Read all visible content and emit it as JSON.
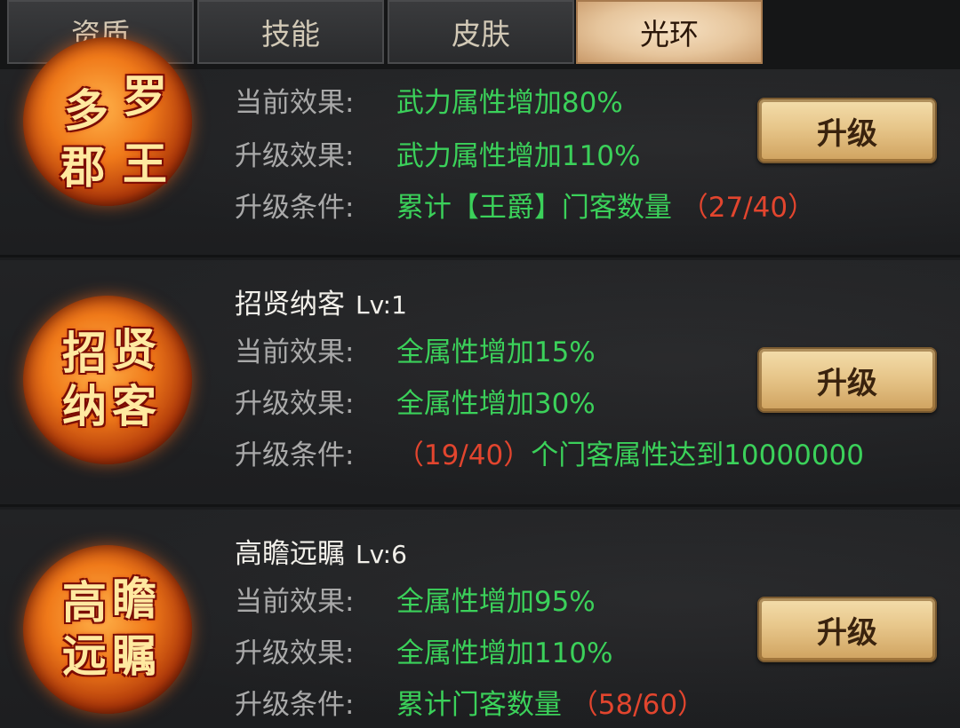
{
  "tabs": [
    {
      "label": "资质"
    },
    {
      "label": "技能"
    },
    {
      "label": "皮肤"
    },
    {
      "label": "光环",
      "active": true
    }
  ],
  "labels": {
    "current": "当前效果:",
    "next": "升级效果:",
    "condition": "升级条件:"
  },
  "upgrade_label": "升级",
  "halos": [
    {
      "emblem": [
        "多",
        "罗",
        "郡",
        "王"
      ],
      "name": "",
      "level": "",
      "current": "武力属性增加80%",
      "next": "武力属性增加110%",
      "condition_prefix": "累计【王爵】门客数量",
      "condition_progress": "（27/40）",
      "condition_suffix": ""
    },
    {
      "emblem": [
        "招",
        "贤",
        "纳",
        "客"
      ],
      "name": "招贤纳客",
      "level": "Lv:1",
      "current": "全属性增加15%",
      "next": "全属性增加30%",
      "condition_prefix": "",
      "condition_progress": "（19/40）",
      "condition_suffix": "个门客属性达到10000000"
    },
    {
      "emblem": [
        "高",
        "瞻",
        "远",
        "瞩"
      ],
      "name": "高瞻远瞩",
      "level": "Lv:6",
      "current": "全属性增加95%",
      "next": "全属性增加110%",
      "condition_prefix": "累计门客数量",
      "condition_progress": "（58/60）",
      "condition_suffix": ""
    }
  ]
}
